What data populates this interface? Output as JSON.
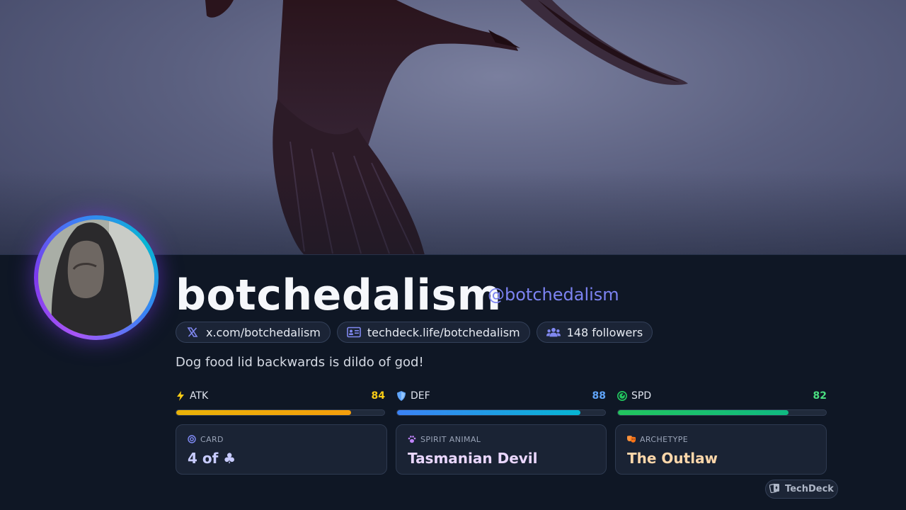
{
  "profile": {
    "name": "botchedalism",
    "handle": "@botchedalism",
    "bio": "Dog food lid backwards is dildo of god!"
  },
  "links": [
    {
      "icon": "x-logo-icon",
      "label": "x.com/botchedalism"
    },
    {
      "icon": "id-card-icon",
      "label": "techdeck.life/botchedalism"
    },
    {
      "icon": "users-icon",
      "label": "148 followers"
    }
  ],
  "stats": [
    {
      "icon": "lightning-icon",
      "label": "ATK",
      "value": "84",
      "level": 0.84,
      "color": "#facc15"
    },
    {
      "icon": "shield-icon",
      "label": "DEF",
      "value": "88",
      "level": 0.88,
      "color": "#60a5fa"
    },
    {
      "icon": "speedometer-icon",
      "label": "SPD",
      "value": "82",
      "level": 0.82,
      "color": "#4ade80"
    }
  ],
  "cards": [
    {
      "icon": "target-icon",
      "label": "CARD",
      "value": "4 of ♣",
      "color": "#c7cbff"
    },
    {
      "icon": "paw-icon",
      "label": "SPIRIT ANIMAL",
      "value": "Tasmanian Devil",
      "color": "#ead7ff"
    },
    {
      "icon": "masks-icon",
      "label": "ARCHETYPE",
      "value": "The Outlaw",
      "color": "#fed7aa"
    }
  ],
  "brand": {
    "label": "TechDeck",
    "icon": "cards-icon"
  },
  "colors": {
    "accent": "#7c83f2",
    "background": "#0f1725"
  }
}
